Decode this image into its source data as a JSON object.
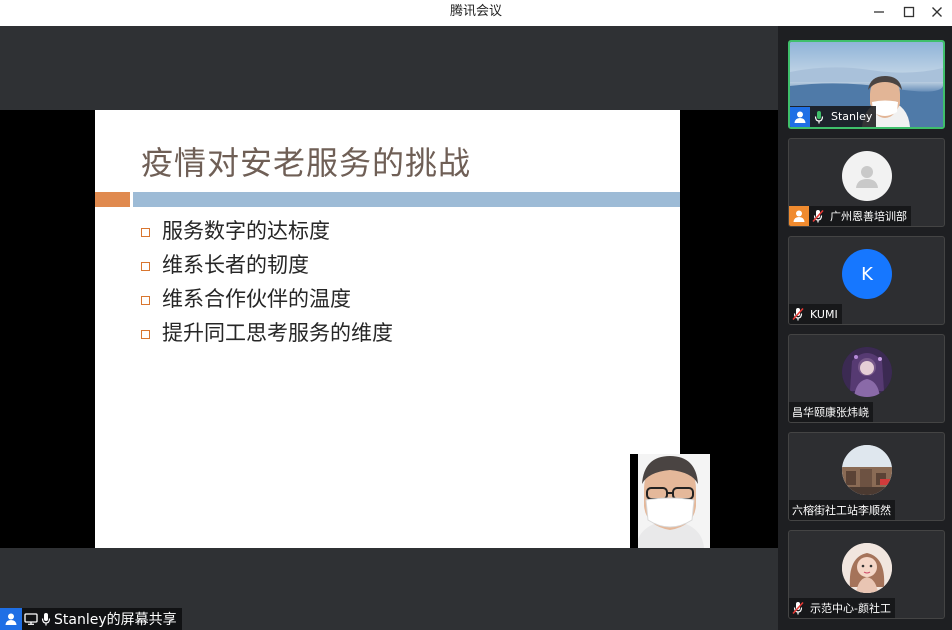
{
  "window": {
    "title": "腾讯会议"
  },
  "slide": {
    "title": "疫情对安老服务的挑战",
    "bullets": [
      "服务数字的达标度",
      "维系长者的韧度",
      "维系合作伙伴的温度",
      "提升同工思考服务的维度"
    ]
  },
  "share_label": {
    "text": "Stanley的屏幕共享"
  },
  "participants": [
    {
      "name": "Stanley",
      "status": "speaking",
      "active": true
    },
    {
      "name": "广州恩善培训部",
      "status": "muted",
      "avatar": "default-avatar"
    },
    {
      "name": "KUMI",
      "status": "muted",
      "avatar_letter": "K"
    },
    {
      "name": "昌华颐康张炜峣",
      "status": "none"
    },
    {
      "name": "六榕街社工站李顺然",
      "status": "none"
    },
    {
      "name": "示范中心-颜社工",
      "status": "muted"
    }
  ],
  "colors": {
    "accent_blue": "#1f6fe5",
    "host_orange": "#f08b2f",
    "active_border": "#3fbf6b",
    "slide_orange": "#e08a4f",
    "slide_blue": "#9dbbd6"
  }
}
